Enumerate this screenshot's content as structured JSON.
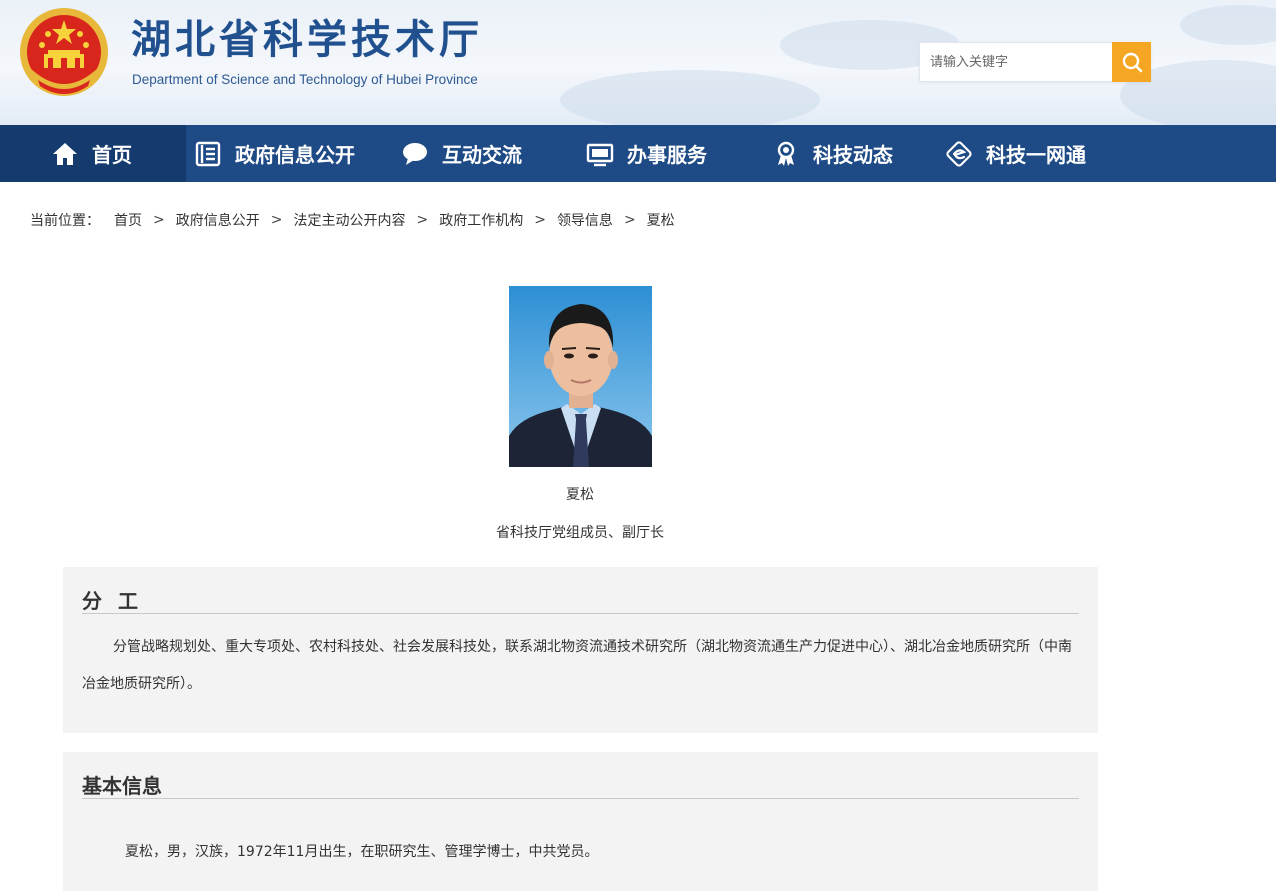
{
  "header": {
    "title": "湖北省科学技术厅",
    "subtitle": "Department of Science and Technology of Hubei Province",
    "search_placeholder": "请输入关键字"
  },
  "nav": {
    "items": [
      {
        "label": "首页",
        "icon": "home-icon",
        "active": true
      },
      {
        "label": "政府信息公开",
        "icon": "document-list-icon",
        "active": false
      },
      {
        "label": "互动交流",
        "icon": "chat-bubble-icon",
        "active": false
      },
      {
        "label": "办事服务",
        "icon": "monitor-icon",
        "active": false
      },
      {
        "label": "科技动态",
        "icon": "award-ribbon-icon",
        "active": false
      },
      {
        "label": "科技一网通",
        "icon": "network-e-icon",
        "active": false
      }
    ]
  },
  "breadcrumb": {
    "prefix": "当前位置：",
    "separator": ">",
    "items": [
      "首页",
      "政府信息公开",
      "法定主动公开内容",
      "政府工作机构",
      "领导信息",
      "夏松"
    ]
  },
  "profile": {
    "name": "夏松",
    "position": "省科技厅党组成员、副厅长"
  },
  "duties": {
    "heading": "分工",
    "text": "分管战略规划处、重大专项处、农村科技处、社会发展科技处，联系湖北物资流通技术研究所（湖北物资流通生产力促进中心）、湖北冶金地质研究所（中南冶金地质研究所）。"
  },
  "basic_info": {
    "heading": "基本信息",
    "text": "夏松，男，汉族，1972年11月出生，在职研究生、管理学博士，中共党员。"
  },
  "colors": {
    "nav_bg": "#1e4a85",
    "nav_active": "#153b6e",
    "title_blue": "#21508f",
    "search_button": "#f5a623",
    "panel_bg": "#f3f3f3"
  }
}
